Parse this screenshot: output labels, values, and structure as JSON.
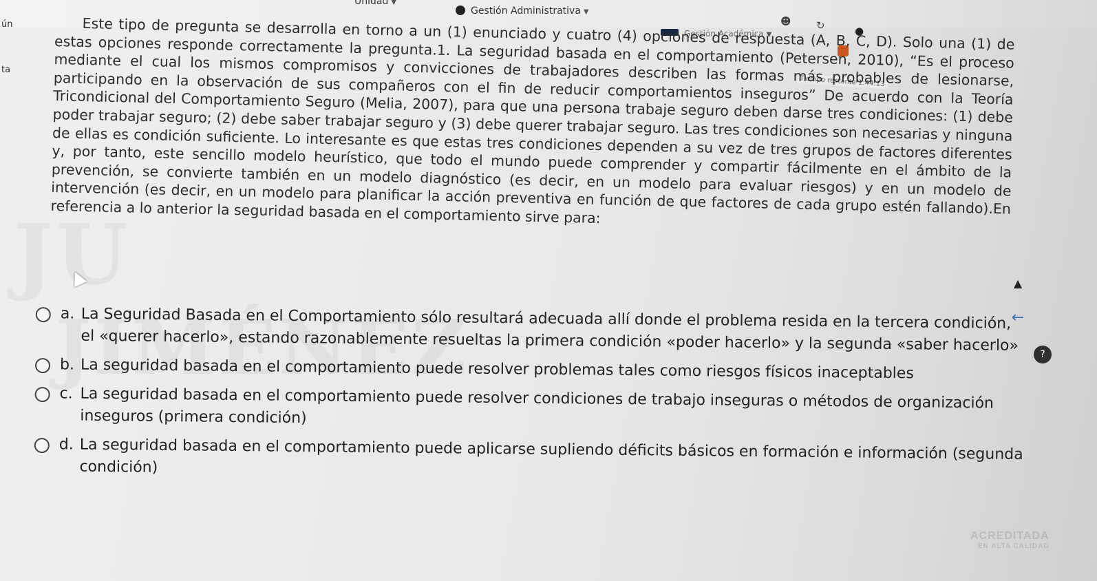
{
  "nav": {
    "item1": "Unidad",
    "item2": "Gestión Administrativa",
    "item3": "Gestión Académica"
  },
  "timer": "Tiempo restante 1:44:13",
  "sidebar": {
    "label1": "ún",
    "label2": "ta"
  },
  "question": {
    "stem": "Este tipo de pregunta se desarrolla en torno a un (1) enunciado y cuatro (4) opciones de respuesta (A, B, C, D). Solo una (1) de estas opciones responde correctamente la pregunta.1. La seguridad basada en el comportamiento (Petersen, 2010), “Es el proceso mediante el cual los mismos compromisos y convicciones de trabajadores describen las formas más probables de lesionarse, participando en la observación de sus compañeros con el fin de reducir comportamientos inseguros” De acuerdo con la Teoría Tricondicional del Comportamiento Seguro (Melia, 2007), para que una persona trabaje seguro deben darse tres condiciones: (1) debe poder trabajar seguro; (2) debe saber trabajar seguro y (3) debe querer trabajar seguro. Las tres condiciones son necesarias y ninguna de ellas es condición suficiente. Lo interesante es que estas tres condiciones dependen a su vez de tres grupos de factores diferentes y, por tanto, este sencillo modelo heurístico, que todo el mundo puede comprender y compartir fácilmente en el ámbito de la prevención, se convierte también en un modelo diagnóstico (es decir, en un modelo para evaluar riesgos) y en un modelo de intervención (es decir, en un modelo para planificar la acción preventiva en función de que factores de cada grupo estén fallando).En referencia a lo anterior la seguridad basada en el comportamiento sirve para:"
  },
  "options": [
    {
      "letter": "a.",
      "text": "La Seguridad Basada en el Comportamiento sólo resultará adecuada allí donde el problema resida en la tercera condición, el «querer hacerlo», estando razonablemente resueltas la primera condición «poder hacerlo» y la segunda «saber hacerlo»"
    },
    {
      "letter": "b.",
      "text": "La seguridad basada en el comportamiento puede resolver problemas tales como riesgos físicos inaceptables"
    },
    {
      "letter": "c.",
      "text": "La seguridad basada en el comportamiento puede resolver condiciones de trabajo inseguras o métodos de organización inseguros (primera condición)"
    },
    {
      "letter": "d.",
      "text": "La seguridad basada en el comportamiento puede aplicarse supliendo déficits básicos en formación e información (segunda condición)"
    }
  ],
  "watermarks": {
    "w1": "JU",
    "w2": "JIMÉNEZ"
  },
  "accreditation": {
    "line1": "ACREDITADA",
    "line2": "EN ALTA CALIDAD"
  },
  "colors": {
    "accent_orange": "#c9571f",
    "nav_icon": "#1b2a44",
    "back_arrow": "#3b6fb6"
  }
}
